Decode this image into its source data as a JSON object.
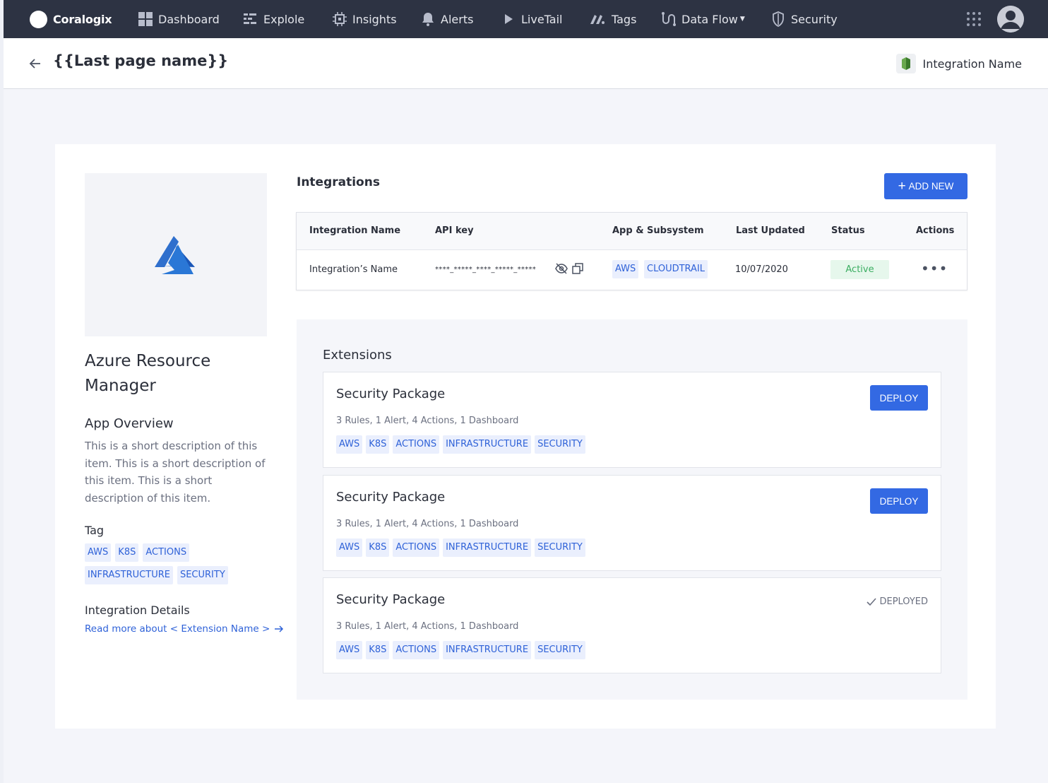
{
  "nav": {
    "brand": "Coralogix",
    "items": [
      {
        "label": "Dashboard",
        "icon": "dashboard-icon"
      },
      {
        "label": "Explole",
        "icon": "explore-icon"
      },
      {
        "label": "Insights",
        "icon": "insights-icon"
      },
      {
        "label": "Alerts",
        "icon": "bell-icon"
      },
      {
        "label": "LiveTail",
        "icon": "play-icon"
      },
      {
        "label": "Tags",
        "icon": "tags-icon"
      },
      {
        "label": "Data Flow",
        "icon": "data-flow-icon"
      },
      {
        "label": "Security",
        "icon": "shield-icon"
      }
    ]
  },
  "header": {
    "title": "{{Last page name}}",
    "integration_name": "Integration Name"
  },
  "app": {
    "name": "Azure Resource Manager",
    "overview_title": "App Overview",
    "overview_text": "This is a short description of this item. This is a short description of this item. This is a short description of this item.",
    "tag_title": "Tag",
    "tags": [
      "AWS",
      "K8S",
      "ACTIONS",
      "INFRASTRUCTURE",
      "SECURITY"
    ],
    "details_title": "Integration Details",
    "read_more": "Read more about < Extension Name >"
  },
  "integrations": {
    "title": "Integrations",
    "add_new": "ADD NEW",
    "columns": [
      "Integration Name",
      "API key",
      "App & Subsystem",
      "Last Updated",
      "Status",
      "Actions"
    ],
    "rows": [
      {
        "name": "Integration’s Name",
        "api_key": "****_*****_****_*****_*****",
        "app": "AWS",
        "subsystem": "CLOUDTRAIL",
        "last_updated": "10/07/2020",
        "status": "Active",
        "actions": "•••"
      }
    ]
  },
  "extensions": {
    "title": "Extensions",
    "items": [
      {
        "title": "Security Package",
        "summary": "3 Rules, 1 Alert, 4 Actions, 1 Dashboard",
        "tags": [
          "AWS",
          "K8S",
          "ACTIONS",
          "INFRASTRUCTURE",
          "SECURITY"
        ],
        "action": "DEPLOY"
      },
      {
        "title": "Security Package",
        "summary": "3 Rules, 1 Alert, 4 Actions, 1 Dashboard",
        "tags": [
          "AWS",
          "K8S",
          "ACTIONS",
          "INFRASTRUCTURE",
          "SECURITY"
        ],
        "action": "DEPLOY"
      },
      {
        "title": "Security Package",
        "summary": "3 Rules, 1 Alert, 4 Actions, 1 Dashboard",
        "tags": [
          "AWS",
          "K8S",
          "ACTIONS",
          "INFRASTRUCTURE",
          "SECURITY"
        ],
        "action": "DEPLOYED"
      }
    ]
  },
  "colors": {
    "nav_bg": "#2d3343",
    "accent": "#3369e3",
    "tag_bg": "#eaeffd",
    "tag_text": "#2f62d8",
    "active_bg": "#e6f7ec",
    "active_text": "#3cae62"
  }
}
